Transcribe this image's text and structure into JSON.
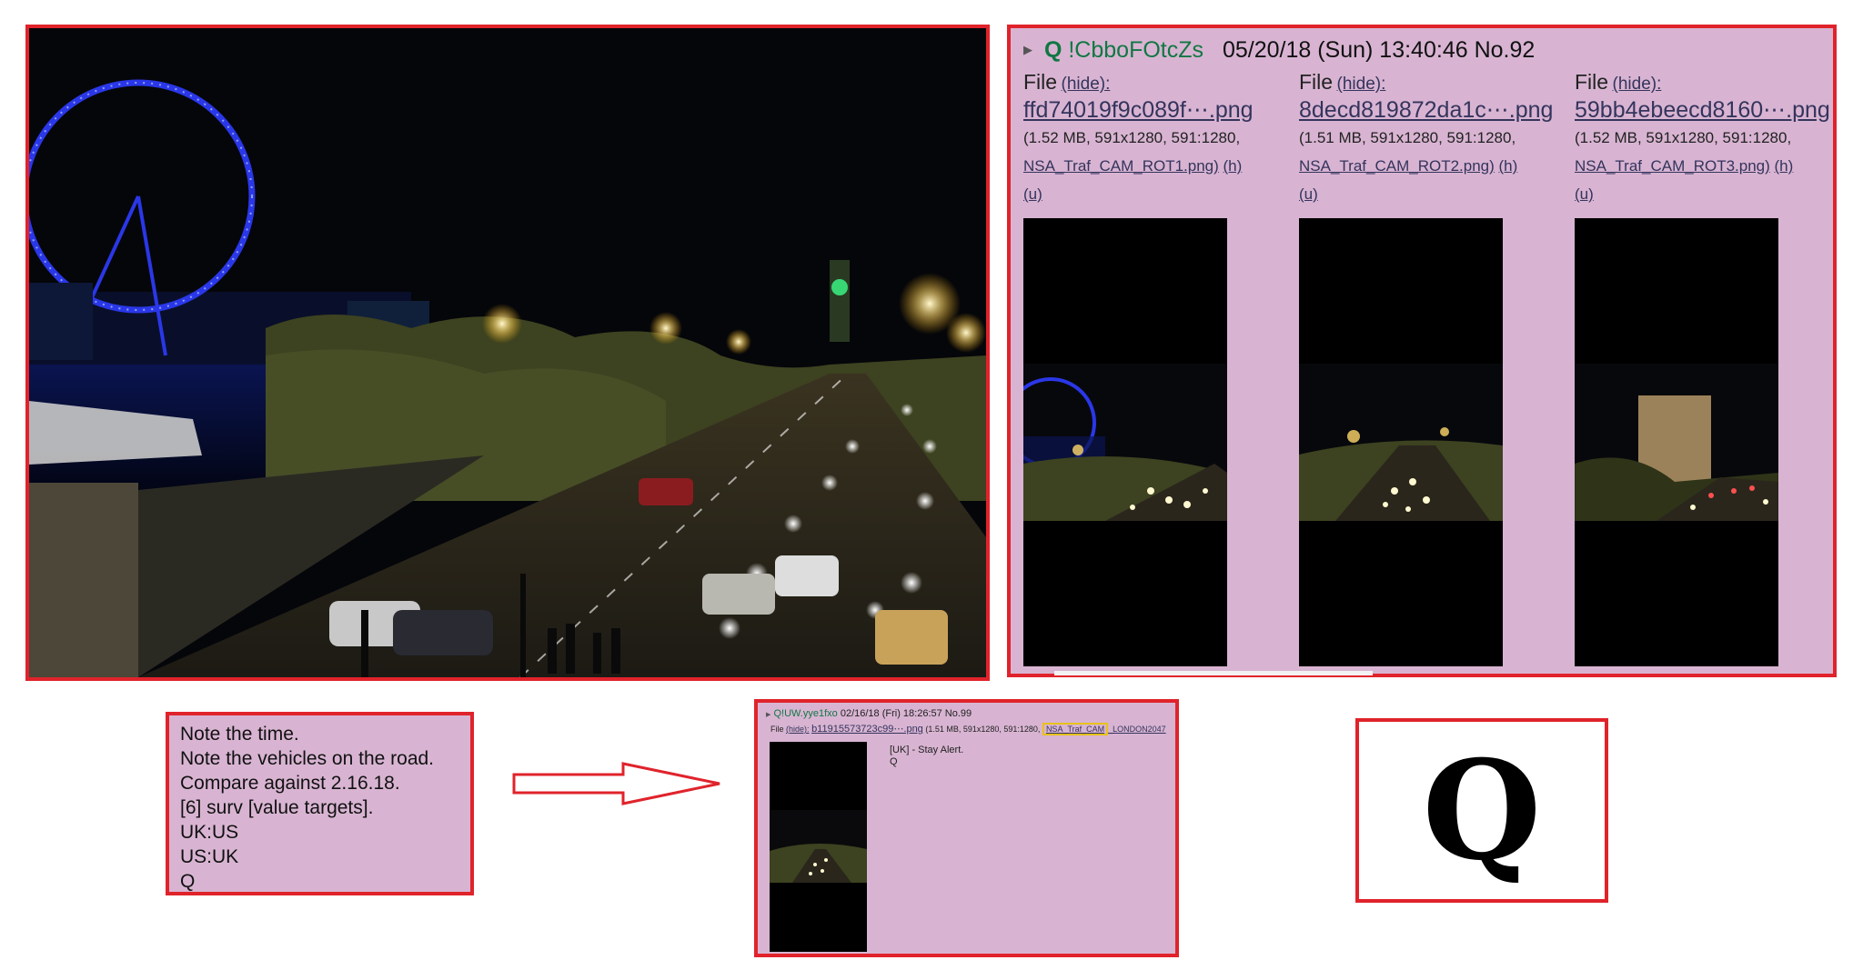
{
  "post": {
    "name": "Q",
    "tripcode": "!CbboFOtcZs",
    "datetime": "05/20/18 (Sun) 13:40:46",
    "post_no": "No.92",
    "files": [
      {
        "label": "File",
        "hide": "(hide):",
        "filename": "ffd74019f9c089f⋯.png",
        "meta": "(1.52 MB, 591x1280, 591:1280,",
        "original": "NSA_Traf_CAM_ROT1.png)",
        "h": "(h)",
        "u": "(u)"
      },
      {
        "label": "File",
        "hide": "(hide):",
        "filename": "8decd819872da1c⋯.png",
        "meta": "(1.51 MB, 591x1280, 591:1280,",
        "original": "NSA_Traf_CAM_ROT2.png)",
        "h": "(h)",
        "u": "(u)"
      },
      {
        "label": "File",
        "hide": "(hide):",
        "filename": "59bb4ebeecd8160⋯.png",
        "meta": "(1.52 MB, 591x1280, 591:1280,",
        "original": "NSA_Traf_CAM_ROT3.png)",
        "h": "(h)",
        "u": "(u)"
      }
    ]
  },
  "note": {
    "lines": [
      "Note the time.",
      "Note the vehicles on the road.",
      "Compare against 2.16.18.",
      "[6] surv [value targets].",
      "UK:US",
      "US:UK",
      "Q"
    ]
  },
  "small_post": {
    "name": "Q",
    "tripcode": "!UW.yye1fxo",
    "datetime": "02/16/18 (Fri) 18:26:57",
    "post_no": "No.99",
    "file_label": "File",
    "hide": "(hide):",
    "filename": "b11915573723c99⋯.png",
    "meta": "(1.51 MB, 591x1280, 591:1280,",
    "original_highlight": "NSA_Traf_CAM",
    "original_rest": "_LONDON2047",
    "message_lines": [
      "[UK] - Stay Alert.",
      "Q"
    ]
  },
  "logo": {
    "letter": "Q"
  },
  "colors": {
    "frame_red": "#e0232b",
    "post_bg": "#d8b4d2",
    "name_green": "#117743",
    "link_blue": "#34345c",
    "eye_blue": "#2a37e8",
    "highlight_yellow": "#e8c21a"
  }
}
